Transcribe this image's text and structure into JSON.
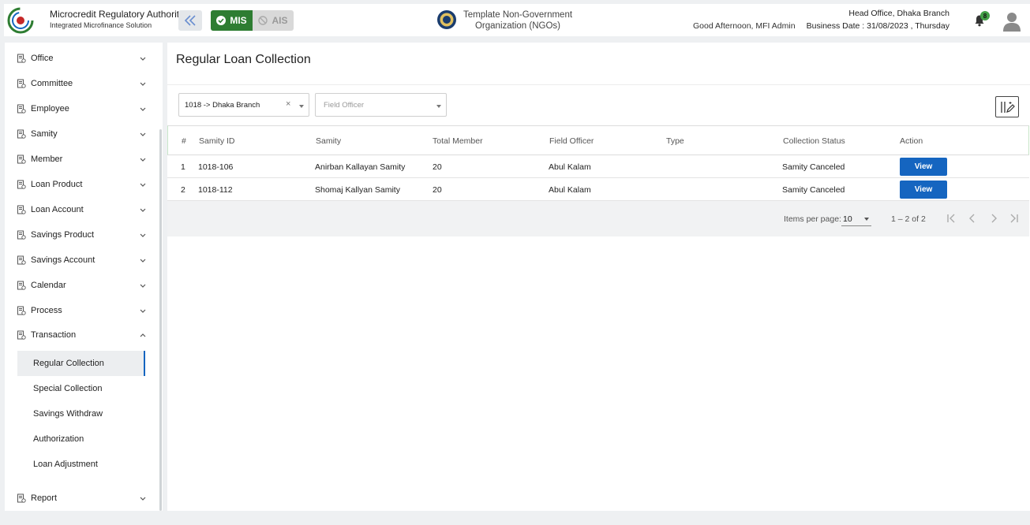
{
  "header": {
    "brand_title": "Microcredit Regulatory Authority",
    "brand_subtitle": "Integrated Microfinance Solution",
    "logo_text": "Microcredit Regulatory Authority",
    "mode_mis": "MIS",
    "mode_ais": "AIS",
    "org_name": "Template Non-Government Organization (NGOs)",
    "greeting": "Good Afternoon, MFI Admin",
    "branch": "Head Office, Dhaka Branch",
    "business_date": "Business Date : 31/08/2023 , Thursday",
    "notification_count": "8",
    "colors": {
      "mis": "#2e7d32",
      "accent": "#1565c0",
      "badge": "#43a047"
    }
  },
  "sidebar": {
    "items": [
      {
        "label": "Office",
        "icon": "building-icon"
      },
      {
        "label": "Committee",
        "icon": "committee-icon"
      },
      {
        "label": "Employee",
        "icon": "employee-icon"
      },
      {
        "label": "Samity",
        "icon": "group-icon"
      },
      {
        "label": "Member",
        "icon": "members-icon"
      },
      {
        "label": "Loan Product",
        "icon": "building-icon"
      },
      {
        "label": "Loan Account",
        "icon": "members-icon"
      },
      {
        "label": "Savings Product",
        "icon": "building-icon"
      },
      {
        "label": "Savings Account",
        "icon": "building-icon"
      },
      {
        "label": "Calendar",
        "icon": "building-icon"
      },
      {
        "label": "Process",
        "icon": "building-icon"
      },
      {
        "label": "Transaction",
        "icon": "building-icon"
      }
    ],
    "transaction_sub": [
      "Regular Collection",
      "Special Collection",
      "Savings Withdraw",
      "Authorization",
      "Loan Adjustment"
    ],
    "report": {
      "label": "Report",
      "icon": "building-icon"
    }
  },
  "main": {
    "title": "Regular Loan Collection",
    "branch_select": {
      "value": "1018 -> Dhaka Branch",
      "clear": "×"
    },
    "officer_select": {
      "placeholder": "Field Officer"
    },
    "columns": [
      "#",
      "Samity ID",
      "Samity",
      "Total Member",
      "Field Officer",
      "Type",
      "Collection Status",
      "Action"
    ],
    "rows": [
      {
        "no": "1",
        "samity_id": "1018-106",
        "samity": "Anirban Kallayan Samity",
        "total_member": "20",
        "field_officer": "Abul Kalam",
        "type": "",
        "status": "Samity Canceled",
        "action": "View"
      },
      {
        "no": "2",
        "samity_id": "1018-112",
        "samity": "Shomaj Kallyan Samity",
        "total_member": "20",
        "field_officer": "Abul Kalam",
        "type": "",
        "status": "Samity Canceled",
        "action": "View"
      }
    ],
    "paginator": {
      "label": "Items per page:",
      "size": "10",
      "range": "1 – 2 of 2"
    }
  }
}
